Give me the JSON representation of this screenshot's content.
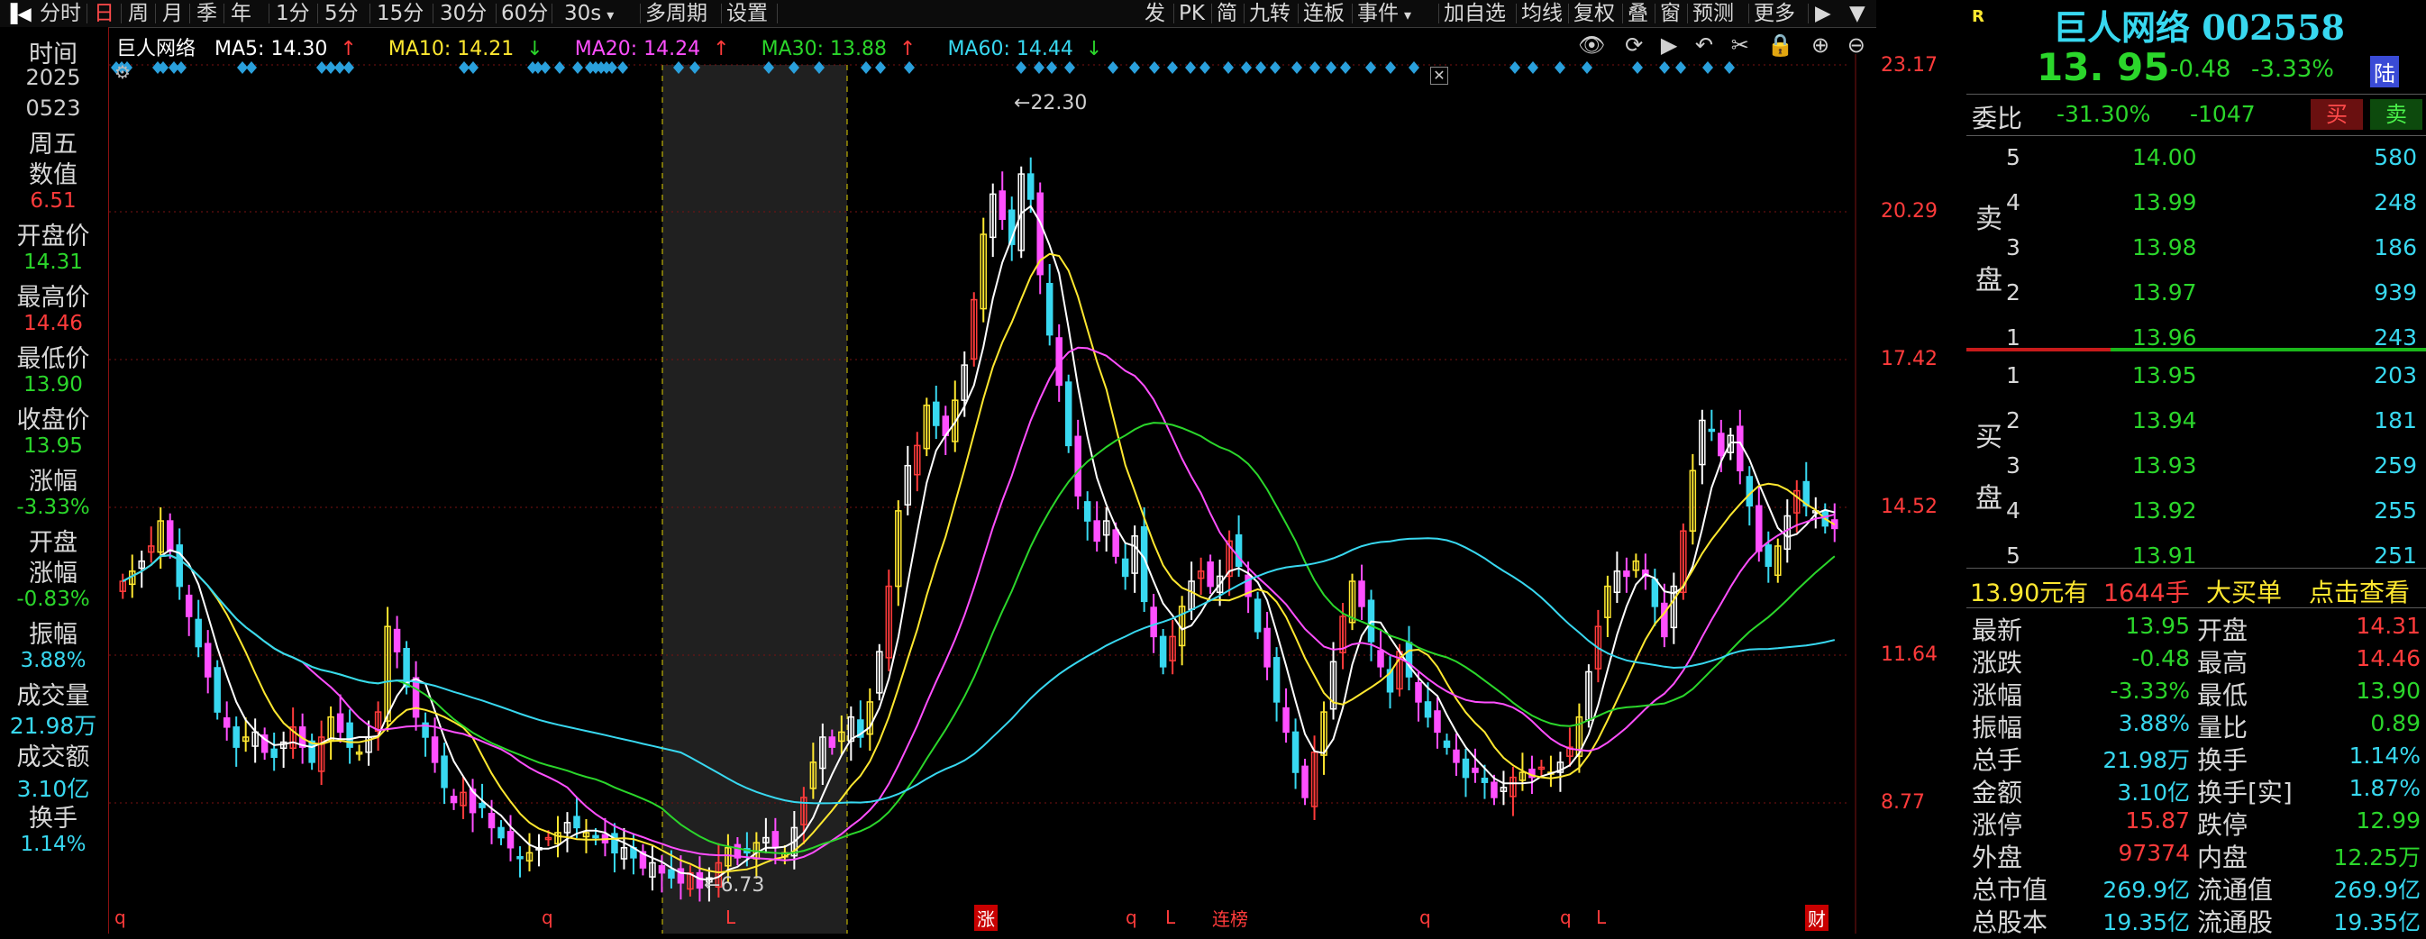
{
  "toolbar": {
    "left": [
      "分时",
      "日",
      "周",
      "月",
      "季",
      "年",
      "1分",
      "5分",
      "15分",
      "30分",
      "60分"
    ],
    "period_select": "30s",
    "multi_period": "多周期",
    "settings": "设置",
    "right": [
      "发",
      "PK",
      "简",
      "九转",
      "连板",
      "事件",
      "加自选",
      "均线",
      "复权",
      "叠",
      "窗",
      "预测",
      "更多"
    ],
    "selected": "日"
  },
  "left_panel": {
    "items": [
      {
        "label": "时间",
        "value": ""
      },
      {
        "label": "2025",
        "value": ""
      },
      {
        "label": "0523",
        "value": ""
      },
      {
        "label": "周五",
        "value": ""
      },
      {
        "label": "数值",
        "value": "6.51"
      },
      {
        "label": "开盘价",
        "value": "14.31"
      },
      {
        "label": "最高价",
        "value": "14.46"
      },
      {
        "label": "最低价",
        "value": "13.90"
      },
      {
        "label": "收盘价",
        "value": "13.95"
      },
      {
        "label": "涨幅",
        "value": "-3.33%"
      },
      {
        "label": "开盘",
        "value": ""
      },
      {
        "label": "涨幅",
        "value": "-0.83%"
      },
      {
        "label": "振幅",
        "value": "3.88%"
      },
      {
        "label": "成交量",
        "value": "21.98万"
      },
      {
        "label": "成交额",
        "value": "3.10亿"
      },
      {
        "label": "换手",
        "value": "1.14%"
      }
    ]
  },
  "chart_header": {
    "name": "巨人网络",
    "ma": [
      {
        "label": "MA5: 14.30",
        "arrow": "↑",
        "color": "#ffffff"
      },
      {
        "label": "MA10: 14.21",
        "arrow": "↓",
        "color": "#ffe830"
      },
      {
        "label": "MA20: 14.24",
        "arrow": "↑",
        "color": "#ff4fff"
      },
      {
        "label": "MA30: 13.88",
        "arrow": "↑",
        "color": "#2bd62b"
      },
      {
        "label": "MA60: 14.44",
        "arrow": "↓",
        "color": "#38d8f0"
      }
    ]
  },
  "chart_data": {
    "type": "candlestick",
    "y_axis_ticks": [
      23.17,
      20.29,
      17.42,
      14.52,
      11.64,
      8.77
    ],
    "ylim": [
      6.0,
      23.17
    ],
    "annotations": {
      "high": "22.30",
      "low": "6.73"
    },
    "bottom_markers": [
      "q",
      "q",
      "L",
      "涨",
      "q",
      "L",
      "连榜",
      "q",
      "q",
      "L",
      "财"
    ],
    "highlight_region": "selected-range",
    "close_series": [
      12.9,
      13.1,
      13.3,
      13.6,
      14.1,
      13.5,
      12.8,
      12.2,
      11.6,
      11.0,
      10.3,
      10.0,
      9.6,
      9.8,
      9.9,
      9.5,
      9.4,
      9.7,
      10.0,
      9.6,
      9.3,
      9.8,
      10.2,
      9.9,
      9.6,
      9.5,
      9.8,
      10.3,
      12.0,
      11.5,
      10.8,
      10.2,
      9.8,
      9.3,
      8.8,
      8.5,
      8.7,
      8.3,
      8.4,
      8.0,
      7.8,
      7.6,
      7.4,
      7.5,
      7.6,
      7.8,
      7.9,
      8.1,
      8.0,
      7.9,
      7.8,
      7.7,
      7.5,
      7.6,
      7.4,
      7.2,
      7.3,
      7.1,
      7.0,
      6.9,
      7.1,
      6.8,
      7.0,
      7.3,
      7.6,
      7.4,
      7.5,
      7.7,
      7.8,
      7.6,
      7.5,
      8.0,
      8.6,
      9.3,
      9.8,
      9.6,
      9.9,
      10.2,
      9.8,
      10.5,
      11.5,
      12.8,
      14.3,
      15.2,
      15.6,
      16.4,
      16.0,
      15.8,
      16.5,
      17.2,
      18.5,
      19.8,
      20.6,
      20.1,
      19.6,
      21.0,
      20.5,
      19.0,
      17.8,
      16.8,
      15.6,
      14.6,
      14.1,
      13.7,
      14.1,
      13.4,
      13.0,
      13.8,
      12.5,
      11.8,
      11.2,
      11.8,
      12.4,
      12.9,
      13.1,
      12.8,
      13.0,
      13.7,
      13.2,
      12.6,
      11.9,
      11.2,
      10.5,
      9.9,
      9.1,
      8.6,
      9.5,
      10.3,
      11.3,
      12.2,
      12.9,
      12.4,
      11.7,
      11.2,
      10.7,
      11.5,
      11.0,
      10.5,
      10.2,
      9.9,
      9.6,
      9.3,
      9.0,
      9.1,
      8.9,
      8.6,
      8.8,
      9.0,
      9.1,
      9.0,
      9.2,
      9.1,
      9.3,
      9.6,
      10.2,
      11.1,
      12.0,
      12.8,
      13.1,
      13.0,
      13.3,
      13.0,
      12.4,
      11.8,
      12.8,
      13.9,
      15.1,
      16.1,
      15.9,
      15.4,
      15.8,
      15.1,
      14.4,
      13.5,
      13.2,
      13.6,
      14.2,
      14.7,
      14.4,
      14.3,
      14.0,
      13.95
    ]
  },
  "quote": {
    "badge": "R",
    "name": "巨人网络",
    "code": "002558",
    "price": "13. 95",
    "change": "-0.48",
    "pct": "-3.33%",
    "market_tag": "陆",
    "ratio_label": "委比",
    "ratio_pct": "-31.30%",
    "ratio_diff": "-1047",
    "buy_btn": "买",
    "sell_btn": "卖",
    "sell_label": [
      "卖",
      "盘"
    ],
    "buy_label": [
      "买",
      "盘"
    ],
    "asks": [
      {
        "lvl": "5",
        "price": "14.00",
        "vol": "580"
      },
      {
        "lvl": "4",
        "price": "13.99",
        "vol": "248"
      },
      {
        "lvl": "3",
        "price": "13.98",
        "vol": "186"
      },
      {
        "lvl": "2",
        "price": "13.97",
        "vol": "939"
      },
      {
        "lvl": "1",
        "price": "13.96",
        "vol": "243"
      }
    ],
    "bids": [
      {
        "lvl": "1",
        "price": "13.95",
        "vol": "203"
      },
      {
        "lvl": "2",
        "price": "13.94",
        "vol": "181"
      },
      {
        "lvl": "3",
        "price": "13.93",
        "vol": "259"
      },
      {
        "lvl": "4",
        "price": "13.92",
        "vol": "255"
      },
      {
        "lvl": "5",
        "price": "13.91",
        "vol": "251"
      }
    ],
    "bigorder": {
      "price": "13.90元有",
      "qty": "1644手",
      "label": "大买单",
      "action": "点击查看"
    },
    "stats": [
      {
        "l": "最新",
        "v": "13.95",
        "c": "green",
        "l2": "开盘",
        "v2": "14.31",
        "c2": "red"
      },
      {
        "l": "涨跌",
        "v": "-0.48",
        "c": "green",
        "l2": "最高",
        "v2": "14.46",
        "c2": "red"
      },
      {
        "l": "涨幅",
        "v": "-3.33%",
        "c": "green",
        "l2": "最低",
        "v2": "13.90",
        "c2": "green"
      },
      {
        "l": "振幅",
        "v": "3.88%",
        "c": "cyan",
        "l2": "量比",
        "v2": "0.89",
        "c2": "green"
      },
      {
        "l": "总手",
        "v": "21.98万",
        "c": "cyan",
        "l2": "换手",
        "v2": "1.14%",
        "c2": "cyan"
      },
      {
        "l": "金额",
        "v": "3.10亿",
        "c": "cyan",
        "l2": "换手[实]",
        "v2": "1.87%",
        "c2": "cyan"
      },
      {
        "l": "涨停",
        "v": "15.87",
        "c": "red",
        "l2": "跌停",
        "v2": "12.99",
        "c2": "green"
      },
      {
        "l": "外盘",
        "v": "97374",
        "c": "red",
        "l2": "内盘",
        "v2": "12.25万",
        "c2": "green"
      },
      {
        "l": "总市值",
        "v": "269.9亿",
        "c": "cyan",
        "l2": "流通值",
        "v2": "269.9亿",
        "c2": "cyan"
      },
      {
        "l": "总股本",
        "v": "19.35亿",
        "c": "cyan",
        "l2": "流通股",
        "v2": "19.35亿",
        "c2": "cyan"
      }
    ]
  },
  "colors": {
    "up": "#ff3b3b",
    "down": "#2bd62b",
    "ma5": "#ffffff",
    "ma10": "#ffe830",
    "ma20": "#ff4fff",
    "ma30": "#2bd62b",
    "ma60": "#38d8f0"
  }
}
